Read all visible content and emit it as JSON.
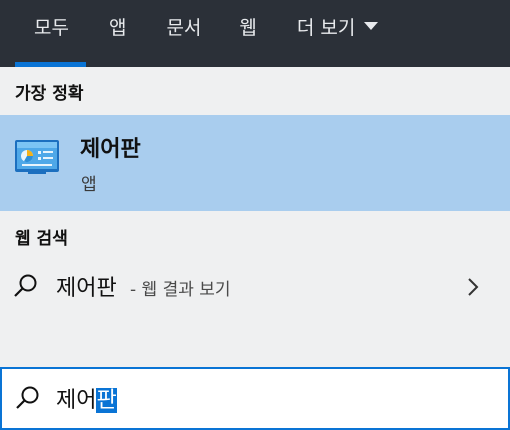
{
  "tabs": [
    {
      "label": "모두",
      "active": true
    },
    {
      "label": "앱",
      "active": false
    },
    {
      "label": "문서",
      "active": false
    },
    {
      "label": "웹",
      "active": false
    },
    {
      "label": "더 보기",
      "active": false,
      "icon": "caret-down-icon"
    }
  ],
  "best_match": {
    "heading": "가장 정확",
    "title": "제어판",
    "subtitle": "앱",
    "icon": "control-panel-icon"
  },
  "web_search": {
    "heading": "웹 검색",
    "query": "제어판",
    "suffix": "- 웹 결과 보기",
    "icon": "search-icon",
    "chevron": "chevron-right-icon"
  },
  "search": {
    "typed": "제어",
    "selected": "판",
    "icon": "search-icon"
  },
  "colors": {
    "accent": "#0a74d5",
    "tabbar_bg": "#2b3038",
    "panel_bg": "#eff0f1",
    "highlight_bg": "#a9cdee"
  }
}
